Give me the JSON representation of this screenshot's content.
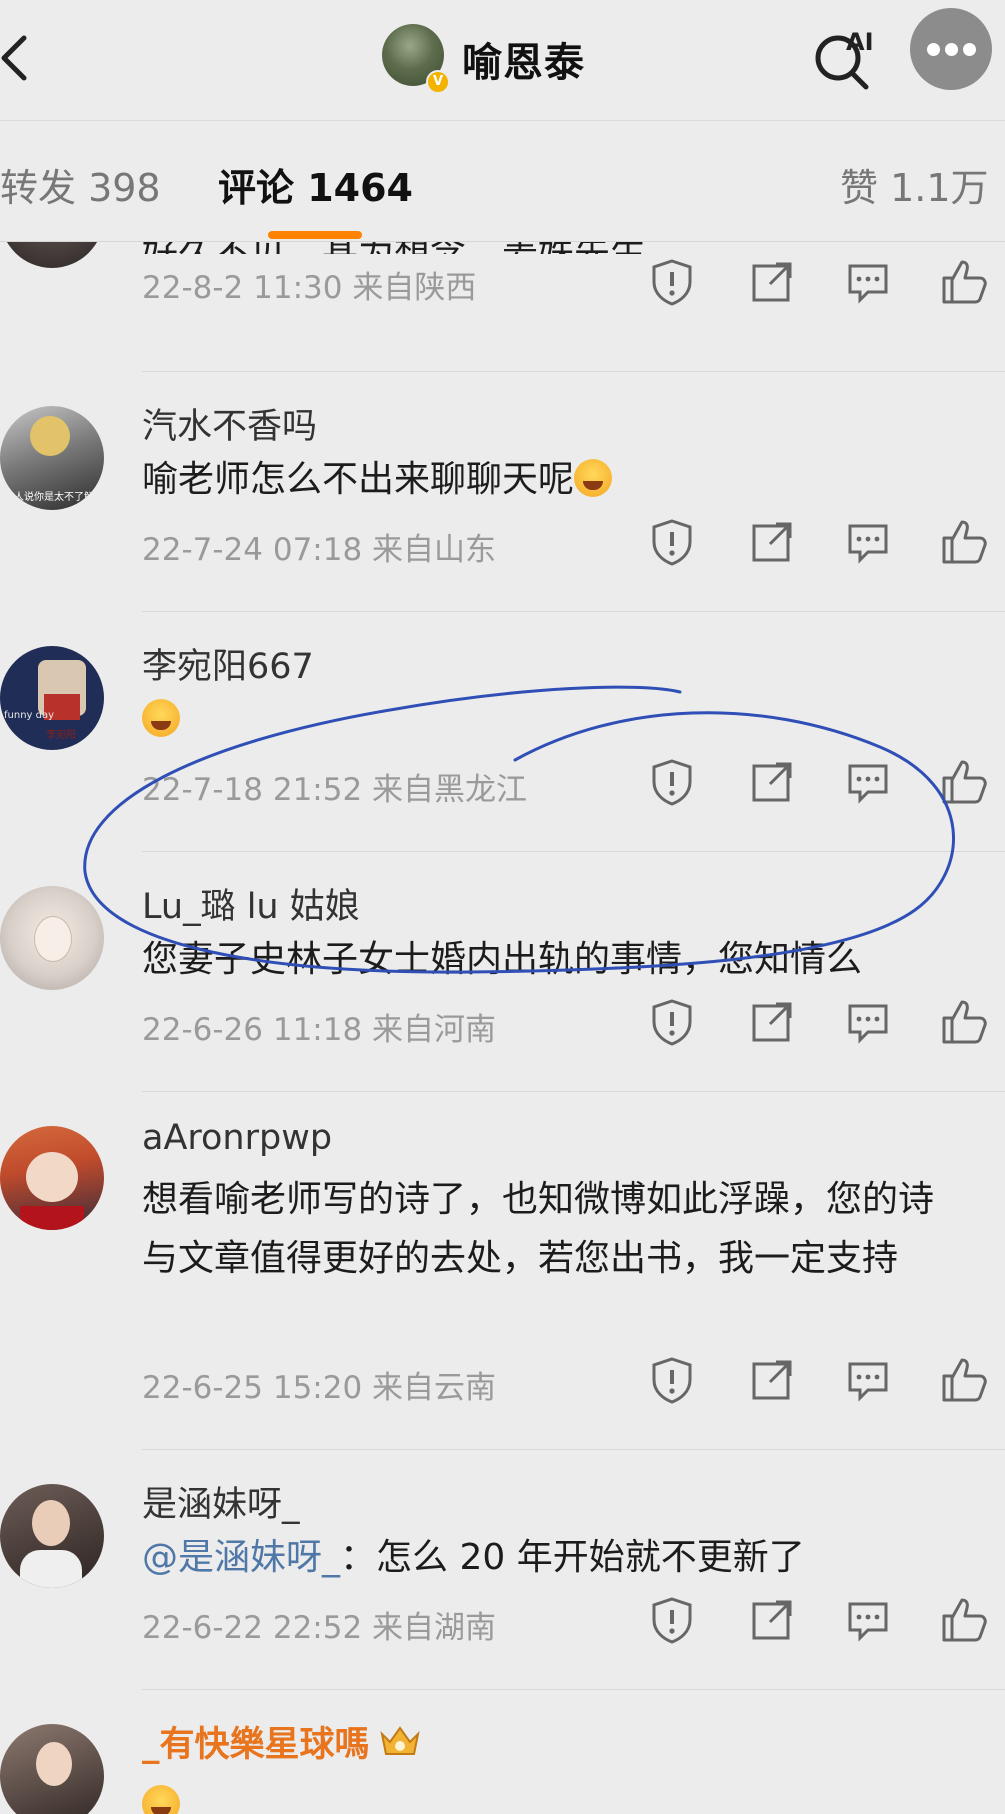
{
  "header": {
    "title": "喻恩泰",
    "ai_label": "AI",
    "verify_mark": "V"
  },
  "tabs": {
    "repost": "转发 398",
    "comments": "评论 1464",
    "likes": "赞 1.1万"
  },
  "accent_color": "#ff8200",
  "comments": [
    {
      "text": "好久不见，甚为想念，姜姝先生",
      "time": "22-8-2 11:30",
      "location": "来自陕西"
    },
    {
      "username": "汽水不香吗",
      "text": "喻老师怎么不出来聊聊天呢",
      "time": "22-7-24 07:18",
      "location": "来自山东",
      "avatar_caption": "有人说你是太不了解"
    },
    {
      "username": "李宛阳667",
      "time": "22-7-18 21:52",
      "location": "来自黑龙江",
      "avatar_caption_1": "funny day",
      "avatar_caption_2": "李宛阳"
    },
    {
      "username": "Lu_璐 lu 姑娘",
      "text": "您妻子史林子女士婚内出轨的事情，您知情么",
      "time": "22-6-26 11:18",
      "location": "来自河南"
    },
    {
      "username": "aAronrpwp",
      "text": "想看喻老师写的诗了，也知微博如此浮躁，您的诗与文章值得更好的去处，若您出书，我一定支持",
      "time": "22-6-25 15:20",
      "location": "来自云南"
    },
    {
      "username": "是涵妹呀_",
      "mention": "@是涵妹呀_",
      "text": "：怎么 20 年开始就不更新了",
      "time": "22-6-22 22:52",
      "location": "来自湖南"
    },
    {
      "username": "_有快樂星球嗎"
    }
  ],
  "icons": [
    "back-icon",
    "ai-search-icon",
    "more-icon",
    "report-icon",
    "share-icon",
    "reply-icon",
    "like-icon"
  ],
  "annotation_color": "#2f4fb6"
}
